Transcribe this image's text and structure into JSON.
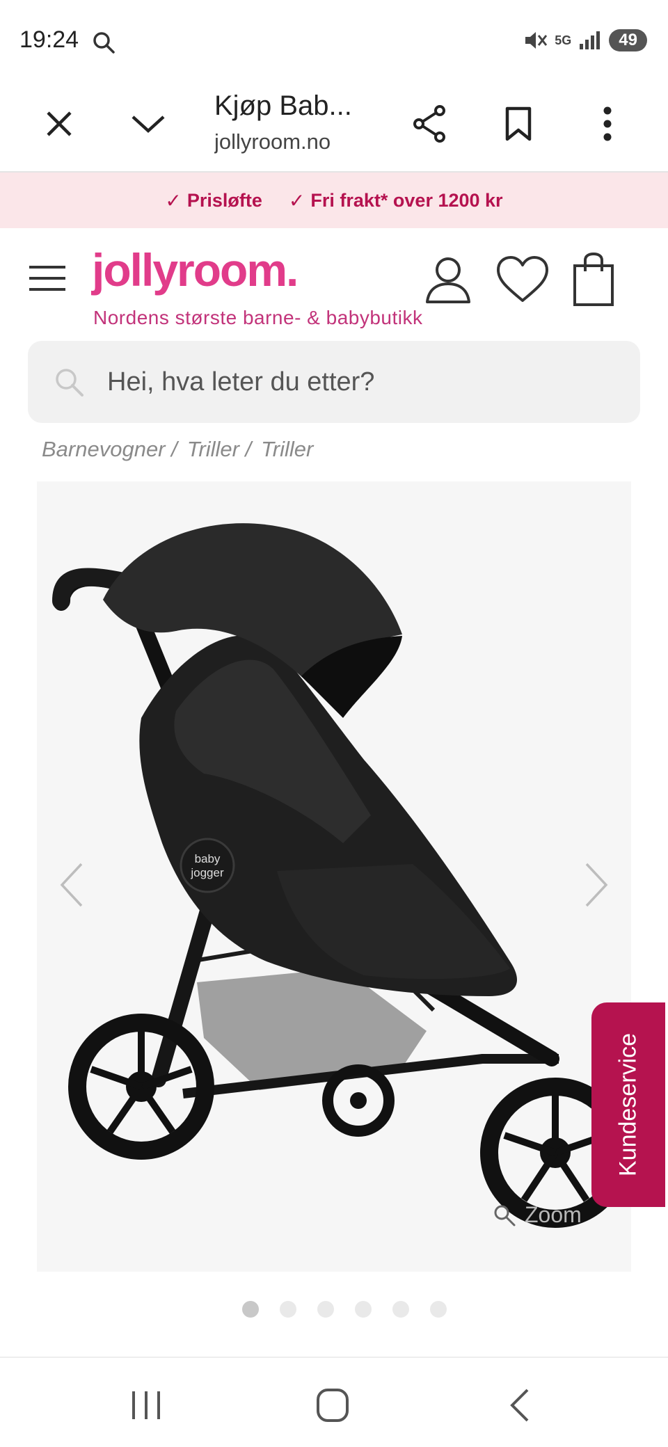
{
  "status_bar": {
    "time": "19:24",
    "battery": "49",
    "network": "5G"
  },
  "browser": {
    "title": "Kjøp Bab...",
    "url": "jollyroom.no"
  },
  "promo": {
    "items": [
      "Prisløfte",
      "Fri frakt* over 1200 kr"
    ]
  },
  "header": {
    "logo": "jollyroom.",
    "tagline": "Nordens største barne- & babybutikk"
  },
  "search": {
    "placeholder": "Hei, hva leter du etter?"
  },
  "breadcrumb": [
    "Barnevogner /",
    "Triller /",
    "Triller"
  ],
  "gallery": {
    "zoom_label": "Zoom",
    "image_count": 6,
    "active_index": 0,
    "product_brand_mark": "baby jogger"
  },
  "support": {
    "label": "Kundeservice"
  },
  "colors": {
    "brand_pink": "#e13c8a",
    "accent_magenta": "#b5134f",
    "promo_bg": "#fbe6e9"
  },
  "icons": [
    "search-icon",
    "close-icon",
    "chevron-down-icon",
    "share-icon",
    "bookmark-icon",
    "more-vert-icon",
    "menu-icon",
    "account-icon",
    "heart-icon",
    "bag-icon",
    "arrow-left-icon",
    "arrow-right-icon",
    "zoom-icon",
    "recent-apps-icon",
    "home-icon",
    "back-icon"
  ]
}
